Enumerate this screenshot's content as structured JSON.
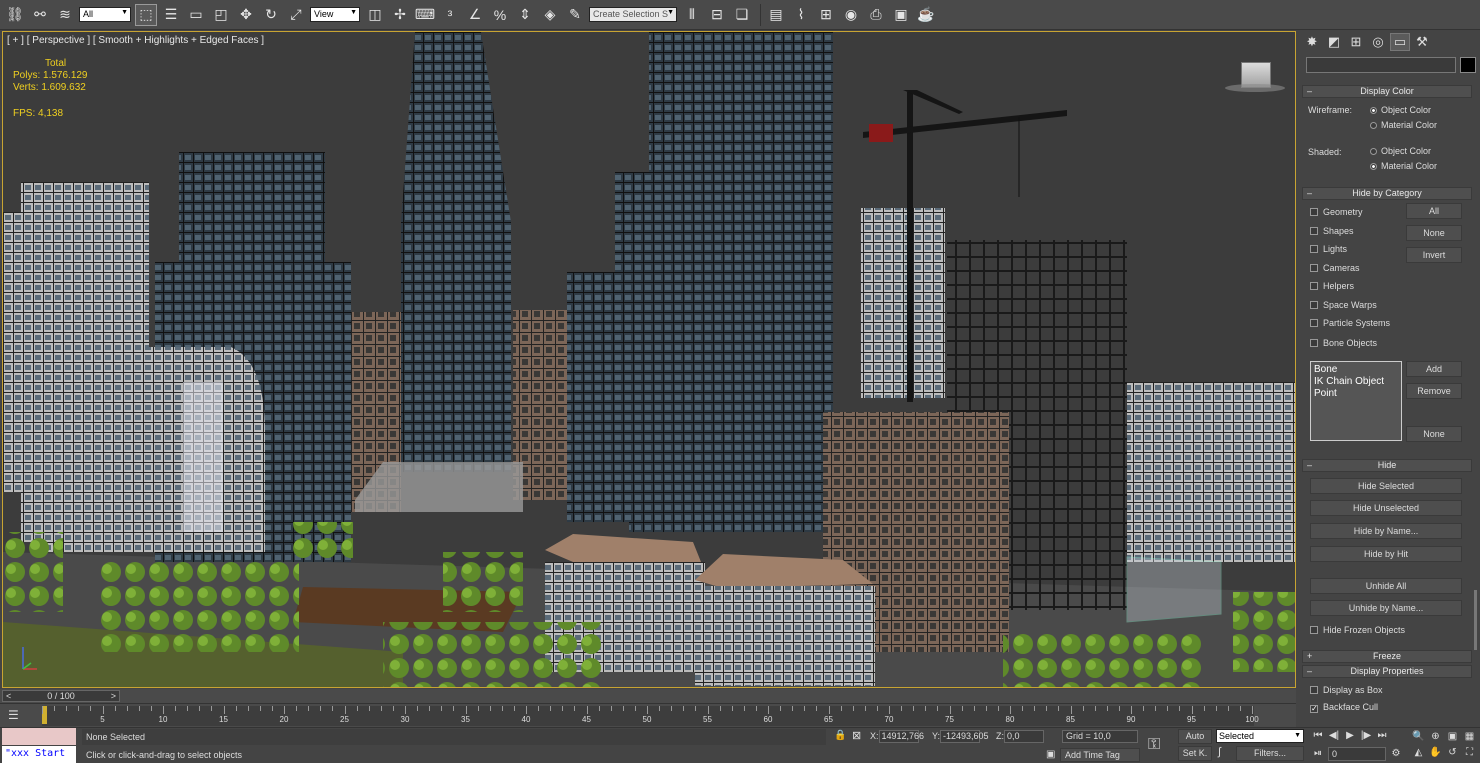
{
  "toolbar": {
    "selection_filter": "All",
    "ref_coord": "View",
    "named_selection": "Create Selection S"
  },
  "viewport": {
    "label": "[ + ] [ Perspective ] [ Smooth + Highlights + Edged Faces ]",
    "stats_total": "Total",
    "polys": "Polys:  1.576.129",
    "verts": "Verts:  1.609.632",
    "fps": "FPS:    4,138"
  },
  "panel": {
    "display_color": {
      "title": "Display Color",
      "wireframe_label": "Wireframe:",
      "shaded_label": "Shaded:",
      "object_color": "Object Color",
      "material_color": "Material Color"
    },
    "hide_by_category": {
      "title": "Hide by Category",
      "items": [
        "Geometry",
        "Shapes",
        "Lights",
        "Cameras",
        "Helpers",
        "Space Warps",
        "Particle Systems",
        "Bone Objects"
      ],
      "all": "All",
      "none": "None",
      "invert": "Invert",
      "list": [
        "Bone",
        "IK Chain Object",
        "Point"
      ],
      "add": "Add",
      "remove": "Remove",
      "none2": "None"
    },
    "hide": {
      "title": "Hide",
      "hide_selected": "Hide Selected",
      "hide_unselected": "Hide Unselected",
      "hide_by_name": "Hide by Name...",
      "hide_by_hit": "Hide by Hit",
      "unhide_all": "Unhide All",
      "unhide_by_name": "Unhide by Name...",
      "hide_frozen": "Hide Frozen Objects"
    },
    "freeze": {
      "title": "Freeze"
    },
    "display_properties": {
      "title": "Display Properties",
      "display_as_box": "Display as Box",
      "backface_cull": "Backface Cull"
    }
  },
  "timeline": {
    "slider": "0 / 100",
    "ticks": [
      5,
      10,
      15,
      20,
      25,
      30,
      35,
      40,
      45,
      50,
      55,
      60,
      65,
      70,
      75,
      80,
      85,
      90,
      95,
      100
    ]
  },
  "status": {
    "maxscript": "\"xxx Start",
    "selection": "None Selected",
    "prompt": "Click or click-and-drag to select objects",
    "x": "14912,766",
    "y": "-12493,605",
    "z": "0,0",
    "x_label": "X:",
    "y_label": "Y:",
    "z_label": "Z:",
    "grid": "Grid = 10,0",
    "add_time_tag": "Add Time Tag",
    "auto": "Auto",
    "set_key": "Set K.",
    "selected": "Selected",
    "filters": "Filters...",
    "frame": "0"
  }
}
